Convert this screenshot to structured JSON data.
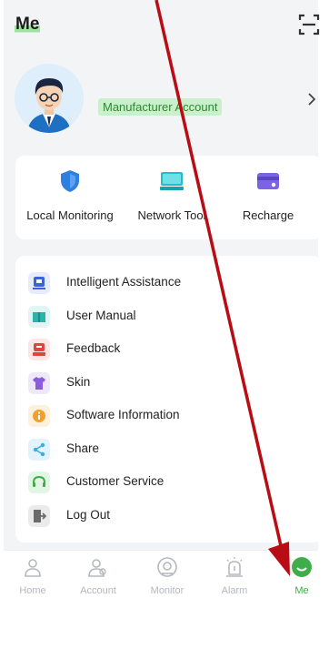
{
  "header": {
    "title": "Me"
  },
  "profile": {
    "account_label": "Manufacturer Account"
  },
  "tools": [
    {
      "label": "Local Monitoring",
      "icon": "shield-icon"
    },
    {
      "label": "Network Tool",
      "icon": "router-icon"
    },
    {
      "label": "Recharge",
      "icon": "card-icon"
    }
  ],
  "menu": [
    {
      "label": "Intelligent Assistance",
      "icon": "assistant-icon"
    },
    {
      "label": "User Manual",
      "icon": "book-icon"
    },
    {
      "label": "Feedback",
      "icon": "feedback-icon"
    },
    {
      "label": "Skin",
      "icon": "shirt-icon"
    },
    {
      "label": "Software Information",
      "icon": "info-icon"
    },
    {
      "label": "Share",
      "icon": "share-icon"
    },
    {
      "label": "Customer Service",
      "icon": "headset-icon"
    },
    {
      "label": "Log Out",
      "icon": "logout-icon"
    }
  ],
  "tabs": [
    {
      "label": "Home",
      "icon": "home-icon"
    },
    {
      "label": "Account",
      "icon": "account-icon"
    },
    {
      "label": "Monitor",
      "icon": "monitor-icon"
    },
    {
      "label": "Alarm",
      "icon": "alarm-icon"
    },
    {
      "label": "Me",
      "icon": "me-icon",
      "active": true
    }
  ],
  "colors": {
    "accent_green": "#3fae4a",
    "highlight_green": "#9fe3a3",
    "annotation_arrow": "#b80d14",
    "background": "#f3f4f6"
  }
}
